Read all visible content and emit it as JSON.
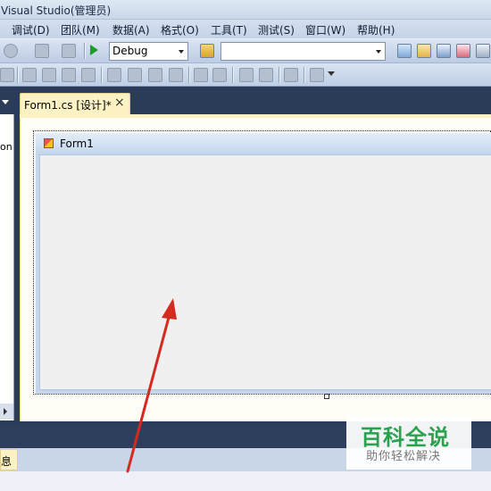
{
  "window": {
    "title": "Visual Studio(管理员)"
  },
  "menu": [
    "调试(D)",
    "团队(M)",
    "数据(A)",
    "格式(O)",
    "工具(T)",
    "测试(S)",
    "窗口(W)",
    "帮助(H)"
  ],
  "toolbar": {
    "config_value": "Debug",
    "platform_value": ""
  },
  "left_panel": {
    "partial_text": "on"
  },
  "document": {
    "tab_title": "Form1.cs [设计]*",
    "tab_close": "×"
  },
  "form": {
    "title": "Form1"
  },
  "bottom": {
    "output_tab": "息"
  },
  "watermark": {
    "main": "百科全说",
    "sub": "助你轻松解决"
  },
  "colors": {
    "accent_tab": "#fdf2c4",
    "doc_background": "#2b3c59",
    "arrow": "#d42a20",
    "watermark_green": "#2aa14f"
  },
  "icons": [
    "redo-icon",
    "undo-history-icon",
    "navigate-icon",
    "start-debug-icon",
    "find-icon",
    "solution-explorer-icon",
    "properties-icon",
    "object-browser-icon",
    "toolbox-icon",
    "align-icon"
  ]
}
